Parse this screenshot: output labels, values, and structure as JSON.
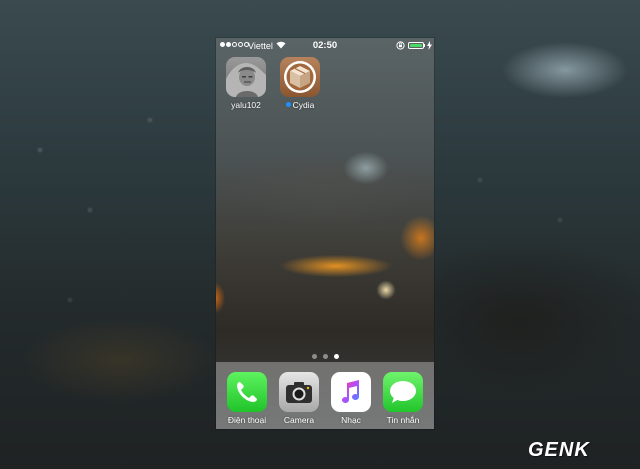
{
  "status_bar": {
    "carrier": "Viettel",
    "time": "02:50",
    "signal_bars_filled": 2,
    "signal_bars_total": 5,
    "battery_level": 1.0
  },
  "home_apps": [
    {
      "label": "yalu102",
      "icon": "yalu-app-icon",
      "new_badge": false
    },
    {
      "label": "Cydia",
      "icon": "cydia-box-icon",
      "new_badge": true
    }
  ],
  "page_indicator": {
    "total": 3,
    "active": 3
  },
  "dock": [
    {
      "label": "Điện thoại",
      "icon": "phone-icon"
    },
    {
      "label": "Camera",
      "icon": "camera-icon"
    },
    {
      "label": "Nhạc",
      "icon": "music-icon"
    },
    {
      "label": "Tin nhắn",
      "icon": "messages-icon"
    }
  ],
  "watermark": {
    "text": "GENK"
  },
  "colors": {
    "battery_green": "#4cd964",
    "new_dot_blue": "#1e90ff"
  }
}
